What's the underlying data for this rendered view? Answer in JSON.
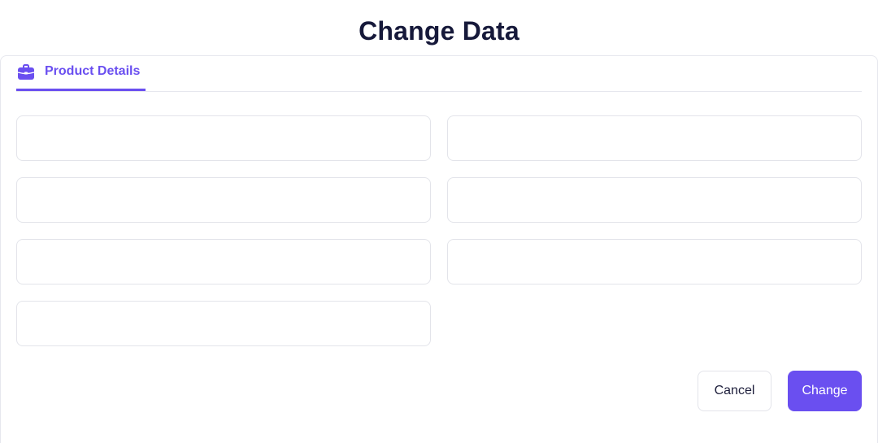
{
  "page": {
    "title": "Change Data"
  },
  "tabs": [
    {
      "label": "Product Details",
      "icon": "briefcase-icon",
      "active": true
    }
  ],
  "form": {
    "fields": [
      {
        "value": "",
        "placeholder": ""
      },
      {
        "value": "",
        "placeholder": ""
      },
      {
        "value": "",
        "placeholder": ""
      },
      {
        "value": "",
        "placeholder": ""
      },
      {
        "value": "",
        "placeholder": ""
      },
      {
        "value": "",
        "placeholder": ""
      },
      {
        "value": "",
        "placeholder": ""
      }
    ]
  },
  "actions": {
    "cancel_label": "Cancel",
    "change_label": "Change"
  },
  "colors": {
    "accent": "#6a4ff0",
    "title": "#16193a",
    "border": "#e3e4ea"
  }
}
